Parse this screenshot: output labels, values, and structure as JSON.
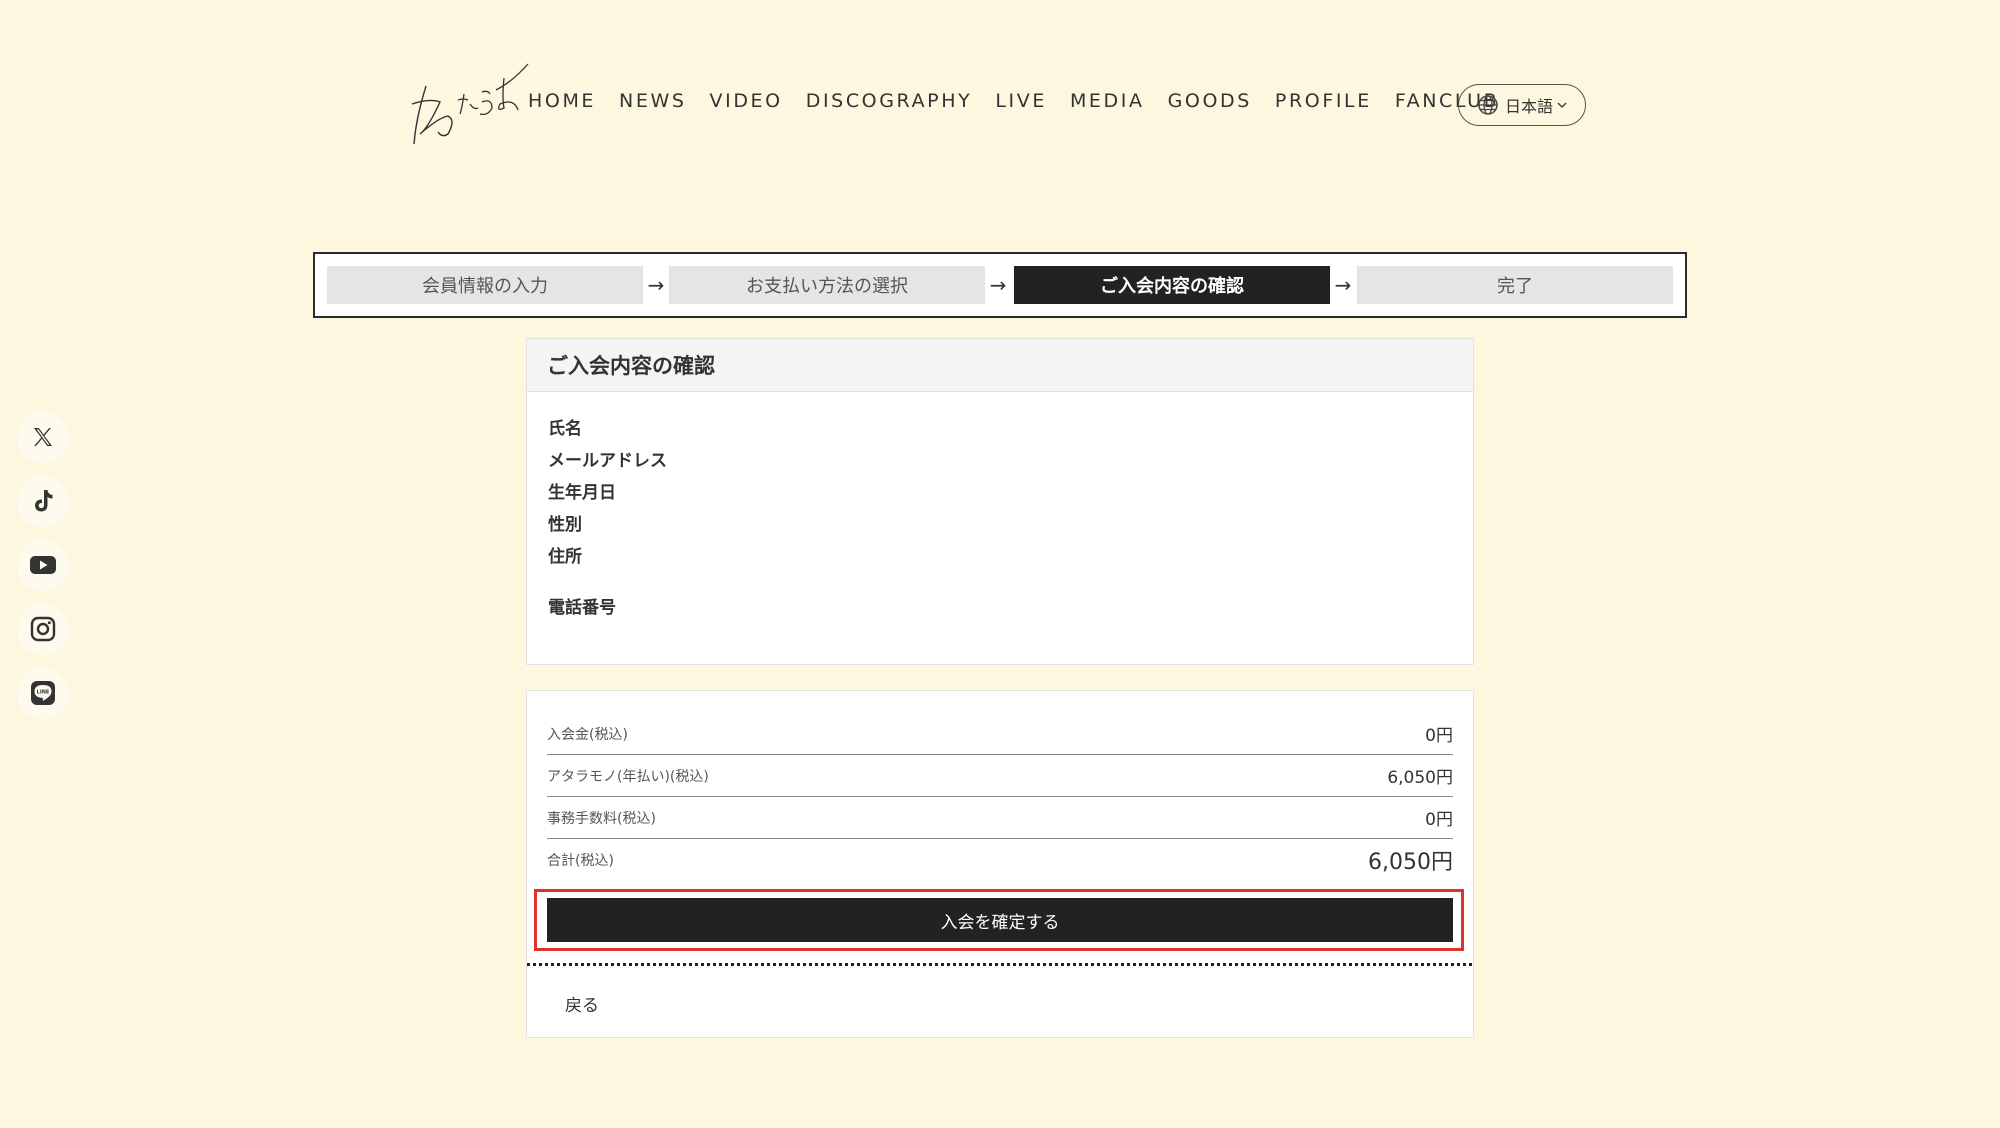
{
  "header": {
    "logo_alt": "あたらよ",
    "nav": [
      "HOME",
      "NEWS",
      "VIDEO",
      "DISCOGRAPHY",
      "LIVE",
      "MEDIA",
      "GOODS",
      "PROFILE",
      "FANCLUB"
    ],
    "language": "日本語"
  },
  "social": [
    {
      "name": "x-icon"
    },
    {
      "name": "tiktok-icon"
    },
    {
      "name": "youtube-icon"
    },
    {
      "name": "instagram-icon"
    },
    {
      "name": "line-icon"
    }
  ],
  "steps": [
    "会員情報の入力",
    "お支払い方法の選択",
    "ご入会内容の確認",
    "完了"
  ],
  "step_arrow": "→",
  "active_step_index": 2,
  "confirm": {
    "title": "ご入会内容の確認",
    "fields": [
      "氏名",
      "メールアドレス",
      "生年月日",
      "性別",
      "住所",
      "電話番号"
    ]
  },
  "payment": {
    "rows": [
      {
        "label": "入会金(税込)",
        "value": "0円"
      },
      {
        "label": "アタラモノ(年払い)(税込)",
        "value": "6,050円"
      },
      {
        "label": "事務手数料(税込)",
        "value": "0円"
      },
      {
        "label": "合計(税込)",
        "value": "6,050円"
      }
    ],
    "confirm_button": "入会を確定する",
    "back_link": "戻る"
  },
  "colors": {
    "background": "#fdf7df",
    "highlight": "#e0342a",
    "button": "#222222"
  }
}
